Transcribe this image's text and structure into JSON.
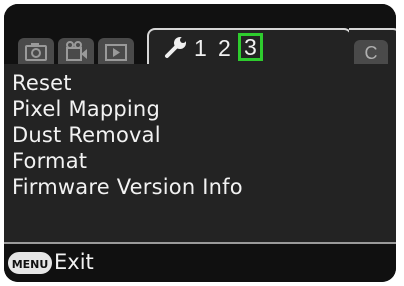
{
  "tabs": {
    "pages": [
      "1",
      "2",
      "3"
    ],
    "selected_page": "3",
    "custom_tab_label": "C",
    "icons": [
      "camera-icon",
      "movie-icon",
      "playback-icon",
      "wrench-icon"
    ]
  },
  "menu": {
    "items": [
      "Reset",
      "Pixel Mapping",
      "Dust Removal",
      "Format",
      "Firmware Version Info"
    ]
  },
  "footer": {
    "button_label": "MENU",
    "action_label": "Exit"
  },
  "colors": {
    "selection_accent": "#2ECC2E",
    "text": "#F2F2F2",
    "panel": "#232323"
  }
}
